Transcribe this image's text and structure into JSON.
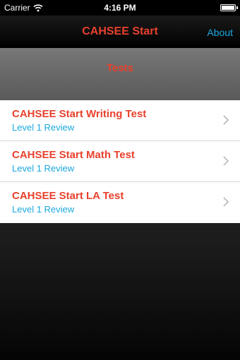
{
  "status_bar": {
    "carrier": "Carrier",
    "time": "4:16 PM"
  },
  "nav": {
    "title": "CAHSEE Start",
    "about_label": "About"
  },
  "section": {
    "title": "Tests"
  },
  "tests": [
    {
      "title": "CAHSEE Start Writing Test",
      "subtitle": "Level 1 Review"
    },
    {
      "title": "CAHSEE Start Math Test",
      "subtitle": "Level 1 Review"
    },
    {
      "title": "CAHSEE Start LA Test",
      "subtitle": "Level 1 Review"
    }
  ],
  "colors": {
    "accent_red": "#e8412c",
    "accent_blue": "#1aa8de"
  },
  "icons": {
    "wifi": "wifi-icon",
    "battery": "battery-icon",
    "chevron": "chevron-right-icon"
  }
}
